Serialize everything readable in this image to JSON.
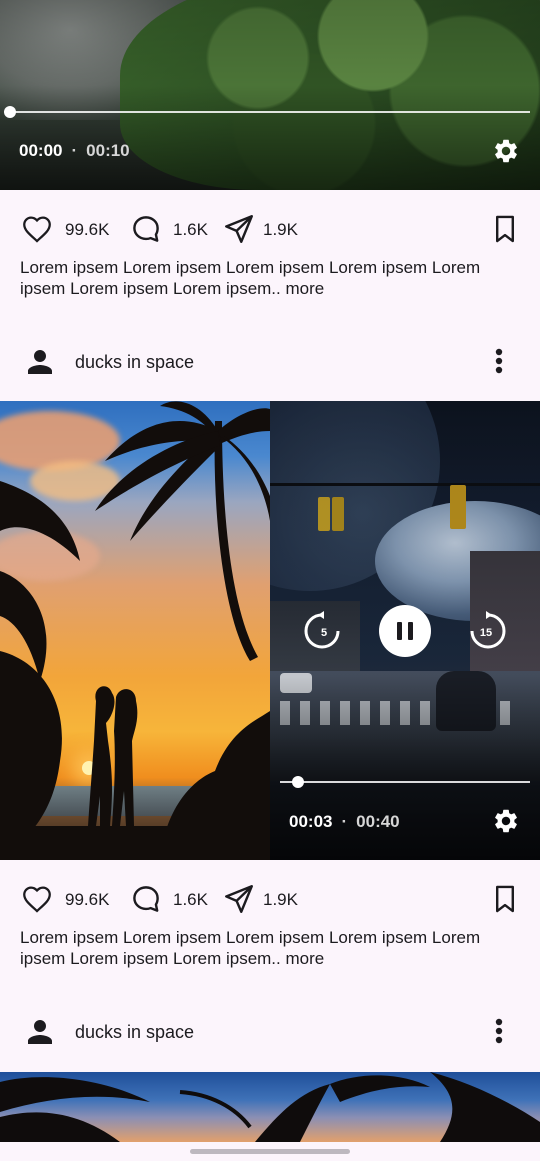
{
  "posts": [
    {
      "video": {
        "current_time": "00:00",
        "duration": "00:10",
        "progress": 0.0
      },
      "likes": "99.6K",
      "comments": "1.6K",
      "shares": "1.9K",
      "caption": "Lorem ipsem Lorem ipsem Lorem ipsem Lorem ipsem Lorem ipsem Lorem ipsem Lorem ipsem..",
      "more_label": "more",
      "author": "ducks in space"
    },
    {
      "video": {
        "current_time": "00:03",
        "duration": "00:40",
        "progress": 0.075,
        "rewind_seconds": "5",
        "forward_seconds": "15"
      },
      "likes": "99.6K",
      "comments": "1.6K",
      "shares": "1.9K",
      "caption": "Lorem ipsem Lorem ipsem Lorem ipsem Lorem ipsem Lorem ipsem Lorem ipsem Lorem ipsem..",
      "more_label": "more",
      "author": "ducks in space"
    }
  ],
  "icons": {
    "like": "heart-outline-icon",
    "comment": "comment-bubble-icon",
    "share": "send-icon",
    "save": "bookmark-outline-icon",
    "settings": "gear-icon",
    "avatar": "person-icon",
    "menu": "more-vert-icon",
    "pause": "pause-icon",
    "rewind": "replay-5-icon",
    "forward": "forward-15-icon"
  },
  "colors": {
    "background": "#fcf5fc",
    "text": "#1c1b1f",
    "overlay_text": "#ffffff"
  }
}
